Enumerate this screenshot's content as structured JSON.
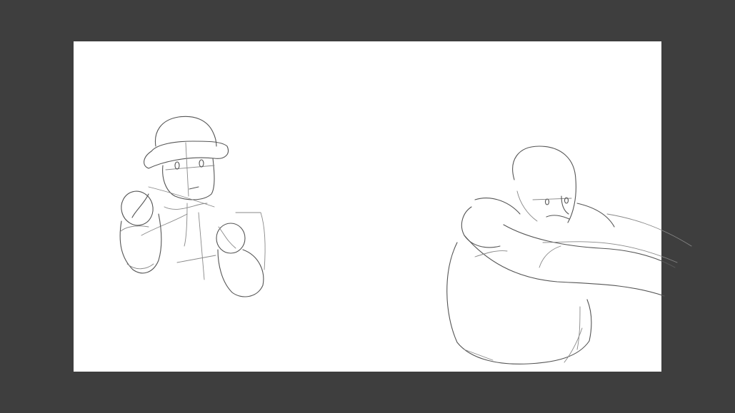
{
  "app": {
    "workspace_background": "#3e3e3e",
    "canvas_background": "#ffffff",
    "stroke_color": "#555555"
  },
  "sketch": {
    "figures": [
      {
        "id": "figure-hat-boxer",
        "description_icon": "pencil-sketch"
      },
      {
        "id": "figure-bald-reaching",
        "description_icon": "pencil-sketch"
      }
    ]
  }
}
